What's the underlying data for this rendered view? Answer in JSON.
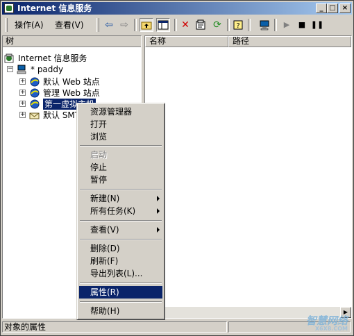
{
  "window": {
    "title": "Internet 信息服务"
  },
  "menubar": {
    "items": [
      "操作(A)",
      "查看(V)"
    ]
  },
  "tree": {
    "header": "树",
    "root": "Internet 信息服务",
    "server": "* paddy",
    "children": [
      "默认 Web 站点",
      "管理 Web 站点",
      "第一虚拟主机",
      "默认 SMTP"
    ]
  },
  "list": {
    "columns": [
      "名称",
      "路径"
    ]
  },
  "context_menu": {
    "items": [
      {
        "label": "资源管理器"
      },
      {
        "label": "打开"
      },
      {
        "label": "浏览"
      },
      {
        "label": "启动",
        "disabled": true
      },
      {
        "label": "停止"
      },
      {
        "label": "暂停"
      },
      {
        "label": "新建(N)",
        "submenu": true
      },
      {
        "label": "所有任务(K)",
        "submenu": true
      },
      {
        "label": "查看(V)",
        "submenu": true
      },
      {
        "label": "删除(D)"
      },
      {
        "label": "刷新(F)"
      },
      {
        "label": "导出列表(L)..."
      },
      {
        "label": "属性(R)",
        "active": true
      },
      {
        "label": "帮助(H)"
      }
    ]
  },
  "statusbar": {
    "text": "对象的属性"
  },
  "watermark": {
    "text": "智慧网络",
    "sub": "X6X8.COM"
  }
}
